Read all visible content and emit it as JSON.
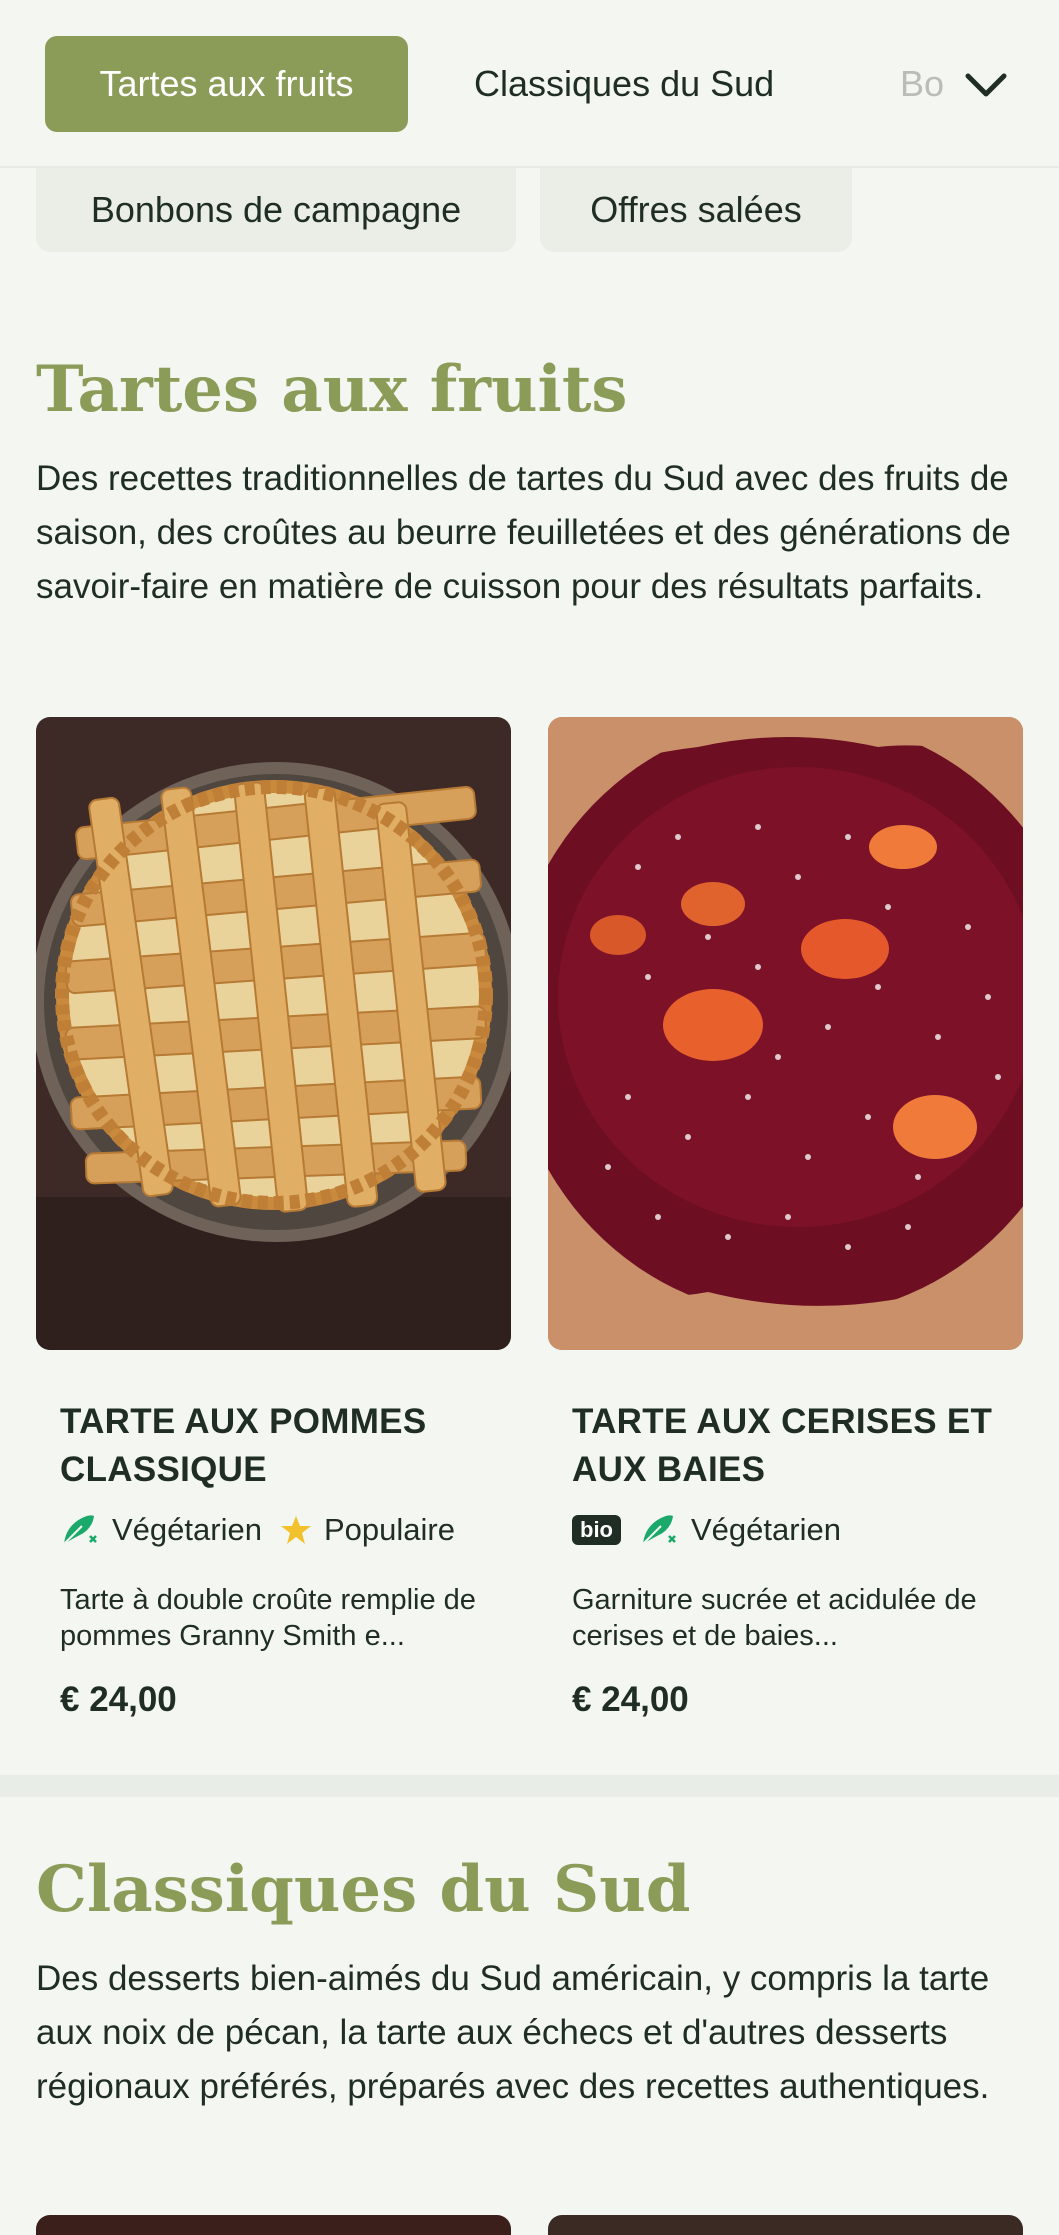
{
  "nav": {
    "tabs": [
      {
        "label": "Tartes aux fruits",
        "active": true
      },
      {
        "label": "Classiques du Sud",
        "active": false
      },
      {
        "label": "Bonbons de campagne",
        "active": false
      },
      {
        "label": "Offres salées",
        "active": false
      }
    ],
    "faded_tab": "Bo",
    "expand_icon": "chevron-down-icon"
  },
  "sections": [
    {
      "title": "Tartes aux fruits",
      "description": "Des recettes traditionnelles de tartes du Sud avec des fruits de saison, des croûtes au beurre feuilletées et des générations de savoir-faire en matière de cuisson pour des résultats parfaits.",
      "products": [
        {
          "name": "TARTE AUX POMMES CLASSIQUE",
          "tags": [
            "Végétarien",
            "Populaire"
          ],
          "description": "Tarte à double croûte remplie de pommes Granny Smith e...",
          "price": "€ 24,00"
        },
        {
          "name": "TARTE AUX CERISES ET AUX BAIES",
          "badge": "bio",
          "tags": [
            "Végétarien"
          ],
          "description": "Garniture sucrée et acidulée de cerises et de baies...",
          "price": "€ 24,00"
        }
      ]
    },
    {
      "title": "Classiques du Sud",
      "description": "Des desserts bien-aimés du Sud américain, y compris la tarte aux noix de pécan, la tarte aux échecs et d'autres desserts régionaux préférés, préparés avec des recettes authentiques."
    }
  ],
  "colors": {
    "accent": "#8b9b58",
    "background": "#f3f6f1",
    "text": "#1f2d24",
    "vegetarian_icon": "#1aa86b",
    "star_icon": "#f2c12e"
  }
}
